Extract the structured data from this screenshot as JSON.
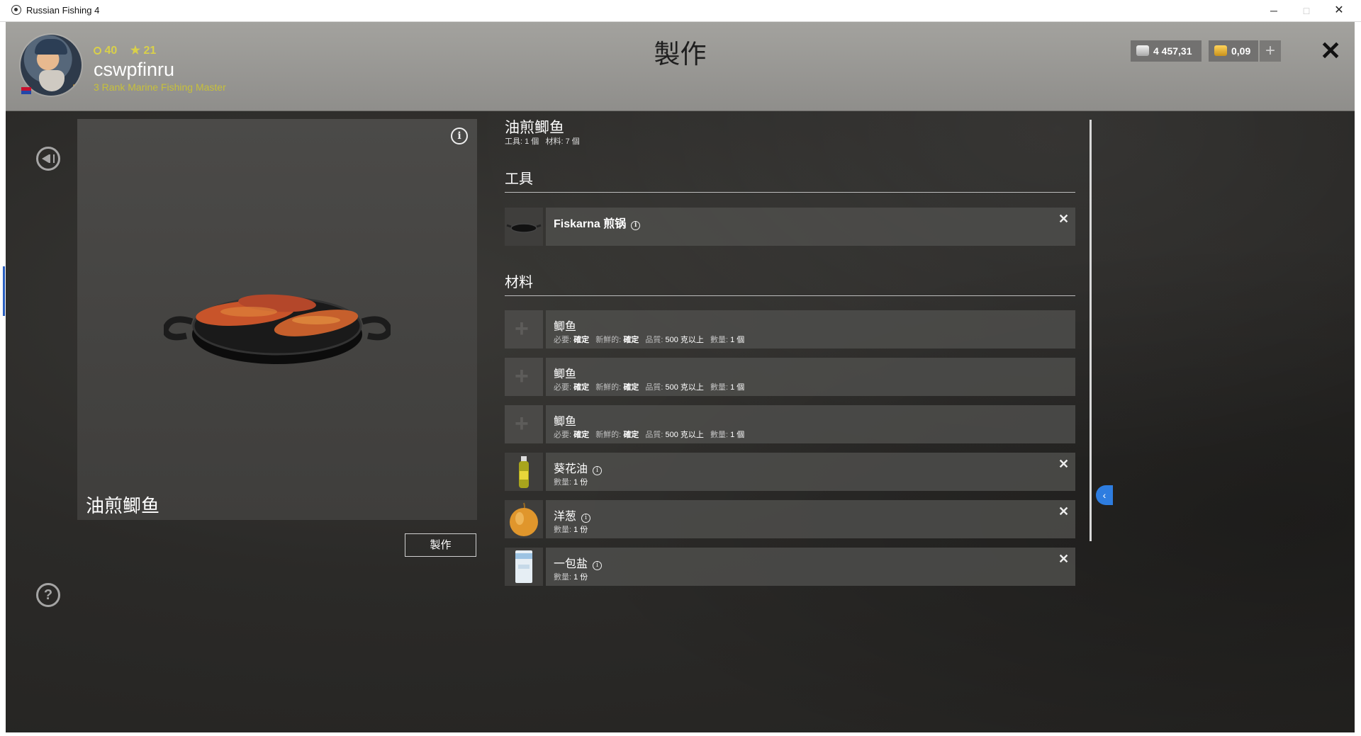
{
  "window": {
    "title": "Russian Fishing 4",
    "minimize": "─",
    "maximize": "□",
    "close": "✕"
  },
  "header": {
    "level": "40",
    "stars": "21",
    "username": "cswpfinru",
    "rank": "3 Rank Marine Fishing Master",
    "page_title": "製作",
    "silver": "4 457,31",
    "gold": "0,09",
    "add_label": "+",
    "close_label": "✕"
  },
  "preview": {
    "info_label": "i",
    "item_name": "油煎鲫鱼",
    "craft_button": "製作",
    "help_label": "?"
  },
  "recipe": {
    "title": "油煎鲫鱼",
    "tools_count_label": "工具: 1 個",
    "materials_count_label": "材料: 7 個",
    "tools_heading": "工具",
    "materials_heading": "材料"
  },
  "tools": [
    {
      "name": "Fiskarna 煎锅",
      "icon": "frying-pan-icon"
    }
  ],
  "materials": [
    {
      "name": "鲫鱼",
      "required_label": "必要:",
      "required": "確定",
      "fresh_label": "新鮮的:",
      "fresh": "確定",
      "quality_label": "品質:",
      "quality": "500 克以上",
      "qty_label": "數量:",
      "qty": "1 個"
    },
    {
      "name": "鲫鱼",
      "required_label": "必要:",
      "required": "確定",
      "fresh_label": "新鮮的:",
      "fresh": "確定",
      "quality_label": "品質:",
      "quality": "500 克以上",
      "qty_label": "數量:",
      "qty": "1 個"
    },
    {
      "name": "鲫鱼",
      "required_label": "必要:",
      "required": "確定",
      "fresh_label": "新鮮的:",
      "fresh": "確定",
      "quality_label": "品質:",
      "quality": "500 克以上",
      "qty_label": "數量:",
      "qty": "1 個"
    },
    {
      "name": "葵花油",
      "qty_label": "數量:",
      "qty": "1 份",
      "icon": "oil-bottle-icon"
    },
    {
      "name": "洋葱",
      "qty_label": "數量:",
      "qty": "1 份",
      "icon": "onion-icon"
    },
    {
      "name": "一包盐",
      "qty_label": "數量:",
      "qty": "1 份",
      "icon": "salt-pack-icon"
    }
  ],
  "remove_label": "✕",
  "empty_slot_label": "+",
  "side_tab_label": "‹"
}
